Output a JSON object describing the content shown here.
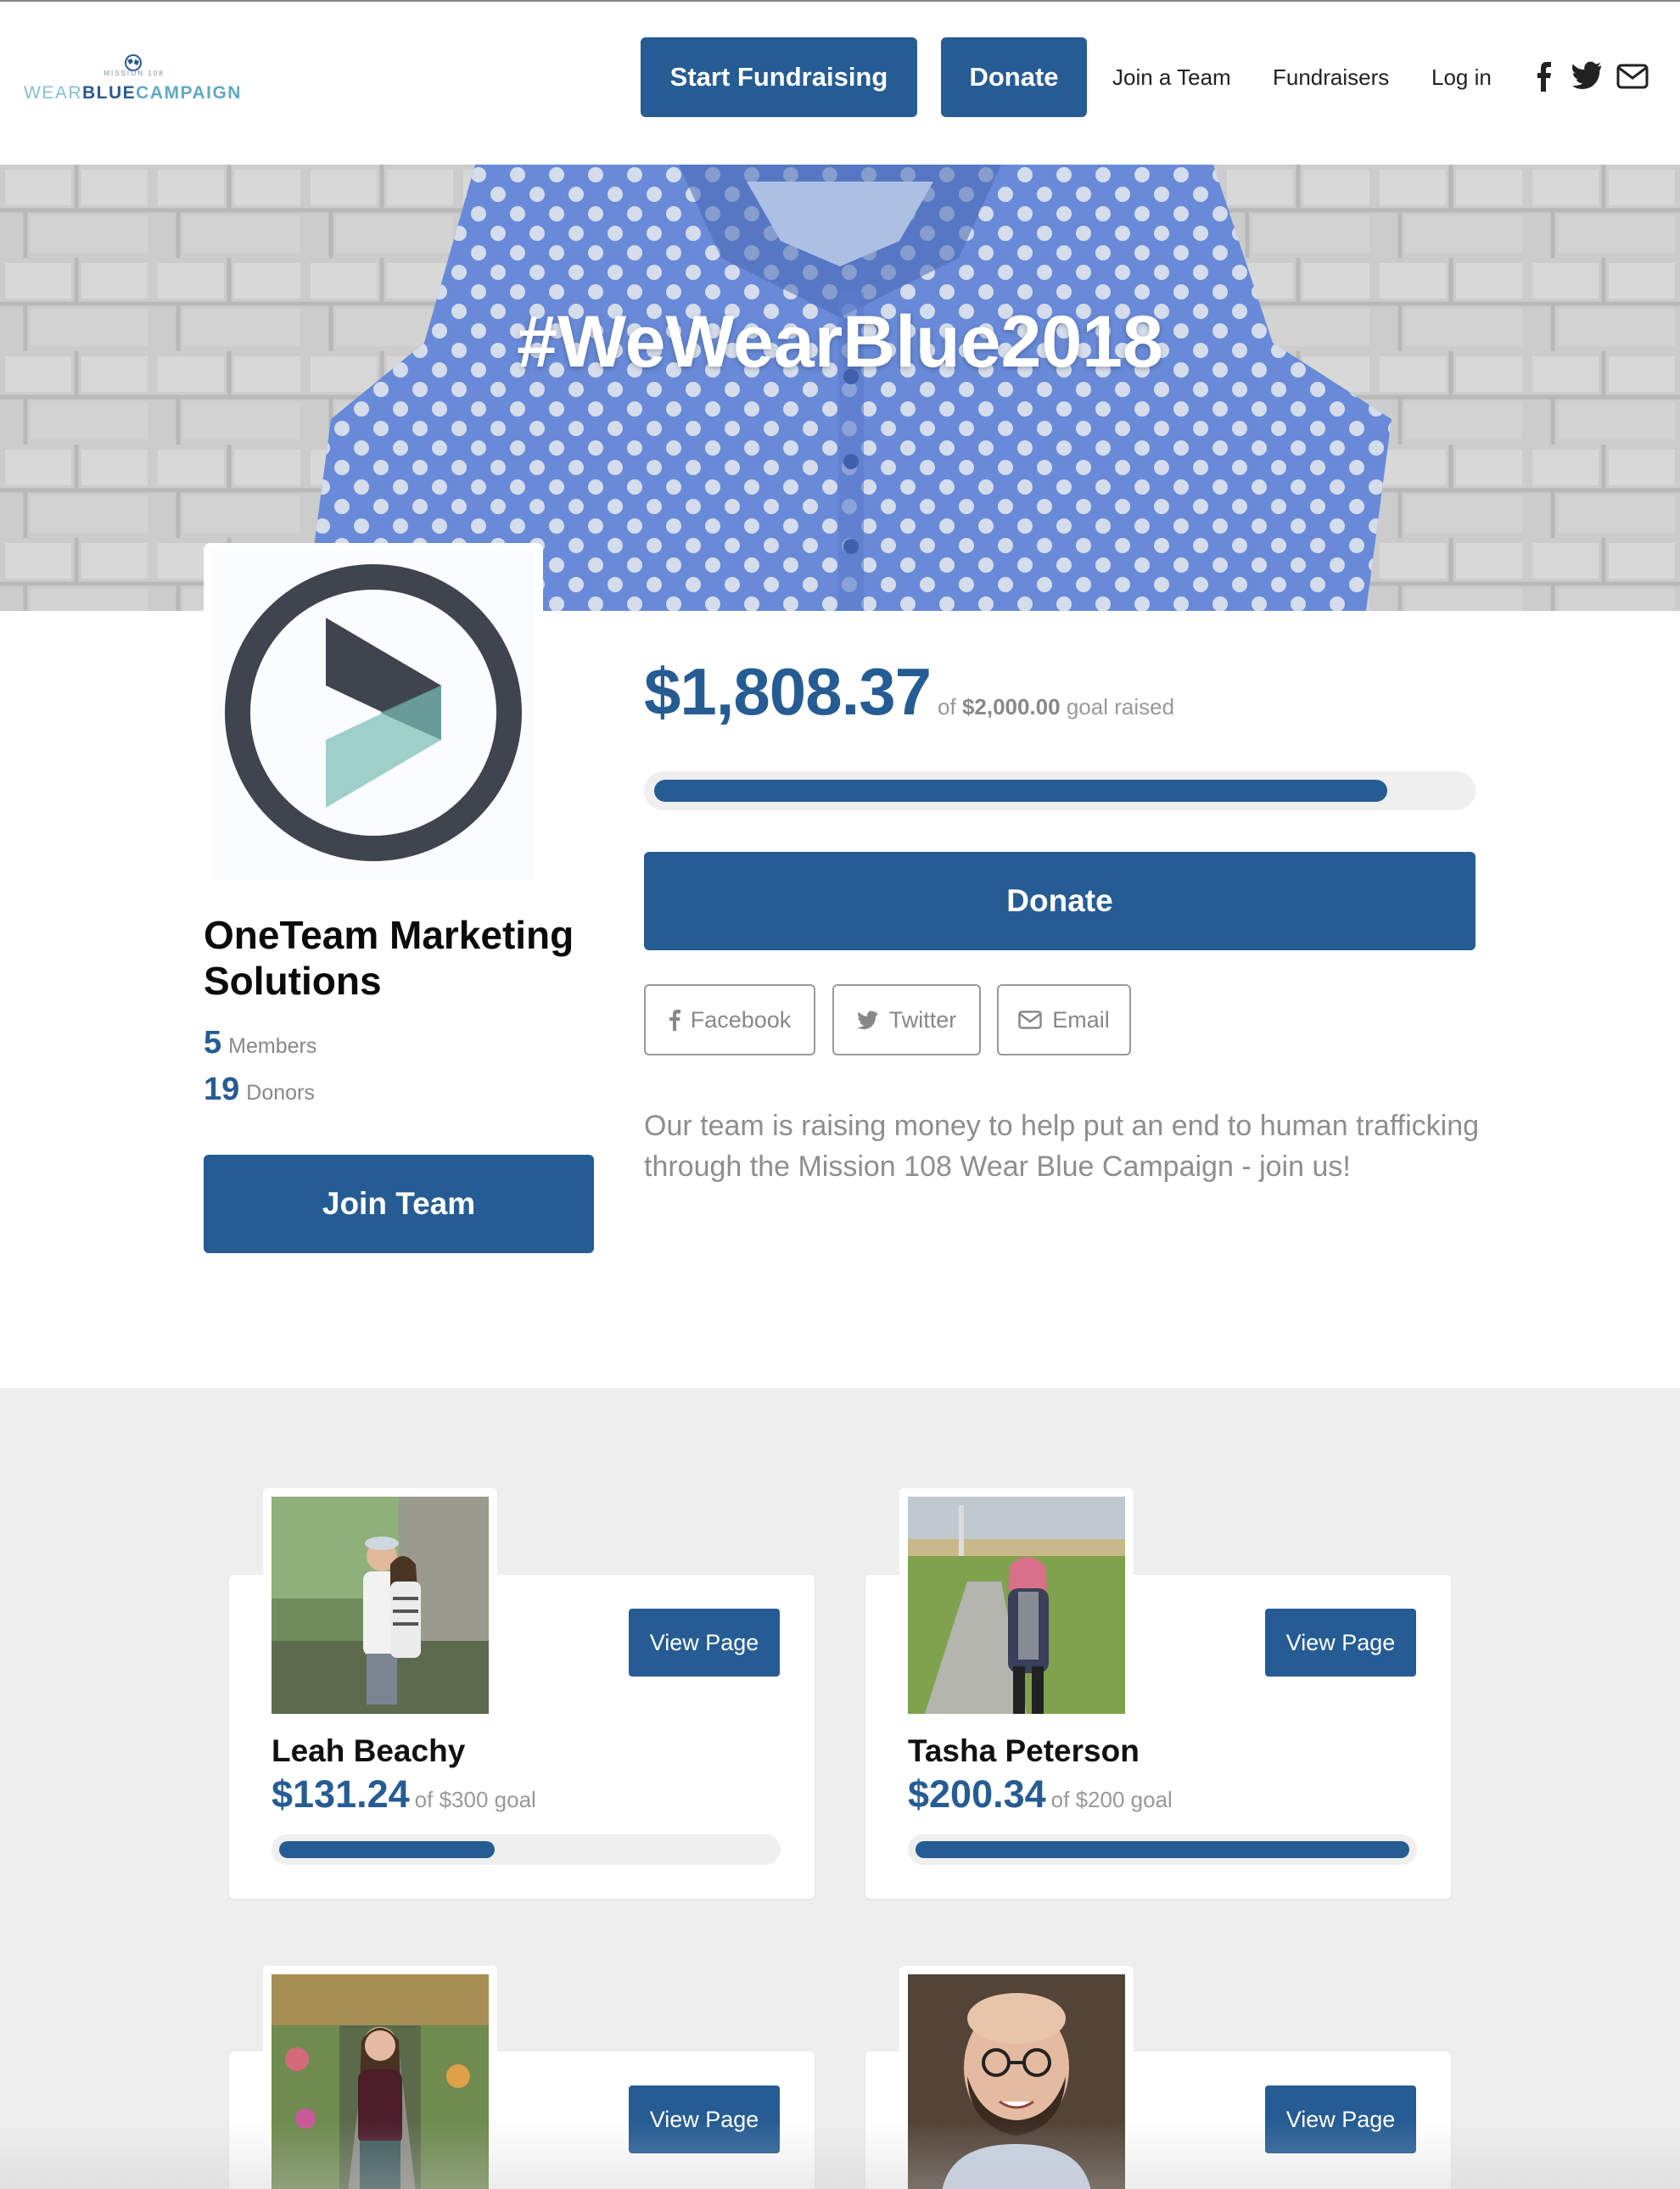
{
  "header": {
    "logo": {
      "tag": "MISSION 108",
      "word1": "WEAR",
      "word2": "BLUE",
      "word3": "CAMPAIGN"
    },
    "start_fundraising": "Start Fundraising",
    "donate": "Donate",
    "nav": [
      "Join a Team",
      "Fundraisers",
      "Log in"
    ],
    "social_icons": [
      "facebook-icon",
      "twitter-icon",
      "email-icon"
    ]
  },
  "hero": {
    "title": "#WeWearBlue2018"
  },
  "team": {
    "name": "OneTeam Marketing Solutions",
    "members_count": "5",
    "members_label": "Members",
    "donors_count": "19",
    "donors_label": "Donors",
    "join_label": "Join Team"
  },
  "fundraising": {
    "raised": "$1,808.37",
    "of_label": "of",
    "goal": "$2,000.00",
    "goal_suffix": "goal raised",
    "progress_fraction": 0.904,
    "donate_label": "Donate",
    "share": [
      "Facebook",
      "Twitter",
      "Email"
    ],
    "description": "Our team is raising money to help put an end to human trafficking through the Mission 108 Wear Blue Campaign - join us!"
  },
  "members": [
    {
      "name": "Leah Beachy",
      "raised": "$131.24",
      "goal": "of $300 goal",
      "progress_fraction": 0.437,
      "view_label": "View Page"
    },
    {
      "name": "Tasha Peterson",
      "raised": "$200.34",
      "goal": "of $200 goal",
      "progress_fraction": 1.0,
      "view_label": "View Page"
    },
    {
      "view_label": "View Page"
    },
    {
      "view_label": "View Page"
    }
  ],
  "colors": {
    "brand": "#265c94",
    "progress_track": "#efefef",
    "section_bg": "#eeeeee"
  }
}
